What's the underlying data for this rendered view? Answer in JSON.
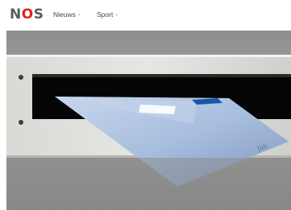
{
  "header": {
    "logo_text": [
      "N",
      "O",
      "S"
    ],
    "nav": [
      {
        "label": "Nieuws",
        "chevron": "chevron-down-icon"
      },
      {
        "label": "Sport",
        "chevron": "chevron-down-icon"
      }
    ]
  },
  "colors": {
    "brand_red": "#e61e14",
    "logo_gray": "#5a5a5a"
  }
}
